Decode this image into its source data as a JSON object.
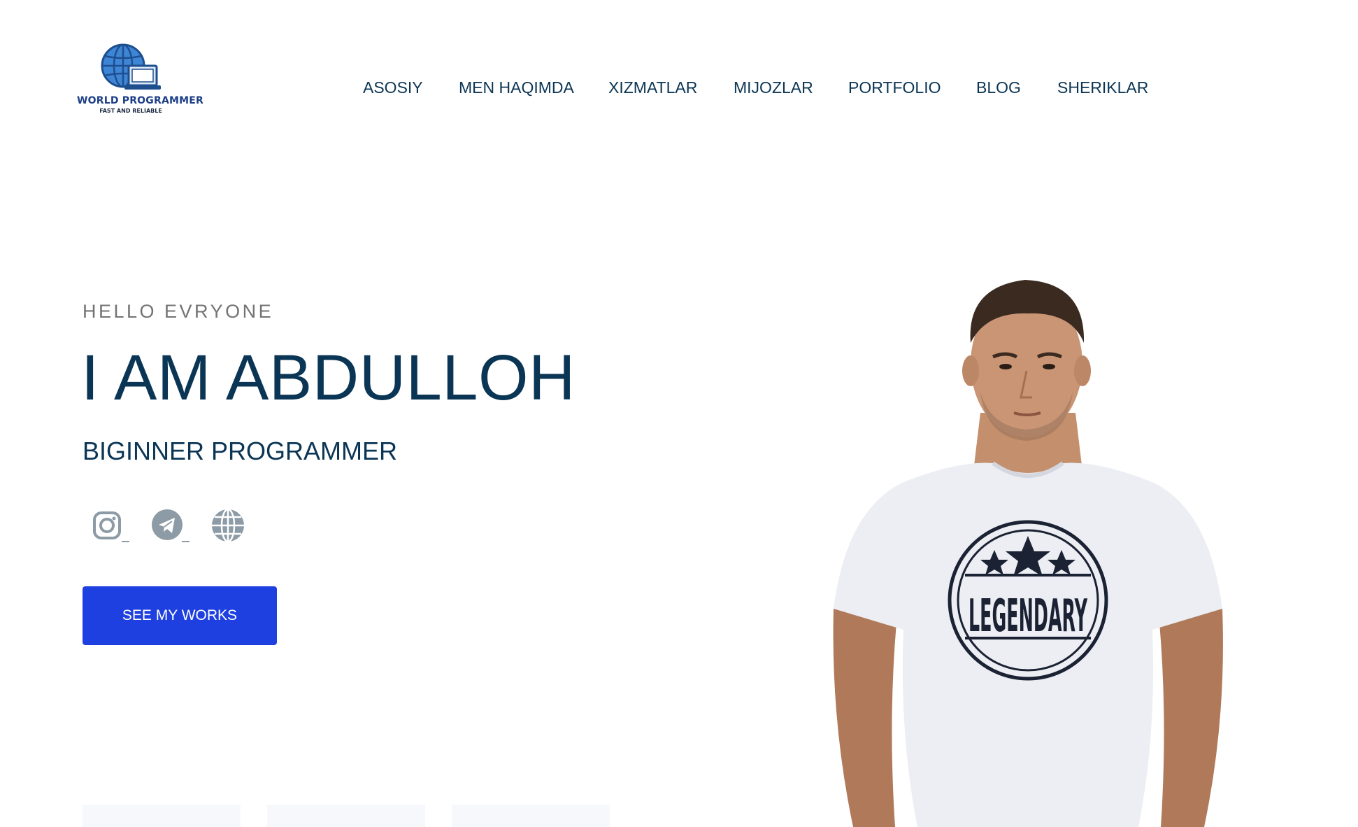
{
  "logo": {
    "title": "WORLD PROGRAMMER",
    "subtitle": "FAST AND RELIABLE"
  },
  "nav": {
    "items": [
      {
        "label": "ASOSIY"
      },
      {
        "label": "MEN HAQIMDA"
      },
      {
        "label": "XIZMATLAR"
      },
      {
        "label": "MIJOZLAR"
      },
      {
        "label": "PORTFOLIO"
      },
      {
        "label": "BLOG"
      },
      {
        "label": "SHERIKLAR"
      }
    ]
  },
  "hero": {
    "greeting": "HELLO EVRYONE",
    "name": "I AM ABDULLOH",
    "role": "BIGINNER PROGRAMMER",
    "socials": [
      {
        "icon": "instagram-icon"
      },
      {
        "icon": "telegram-icon"
      },
      {
        "icon": "globe-icon"
      }
    ],
    "cta_label": "SEE MY WORKS",
    "shirt_text": "LEGENDARY"
  },
  "colors": {
    "primary_text": "#0b3554",
    "accent_button": "#1f40e0",
    "muted_text": "#737373",
    "icon_gray": "#8c9ba5"
  }
}
